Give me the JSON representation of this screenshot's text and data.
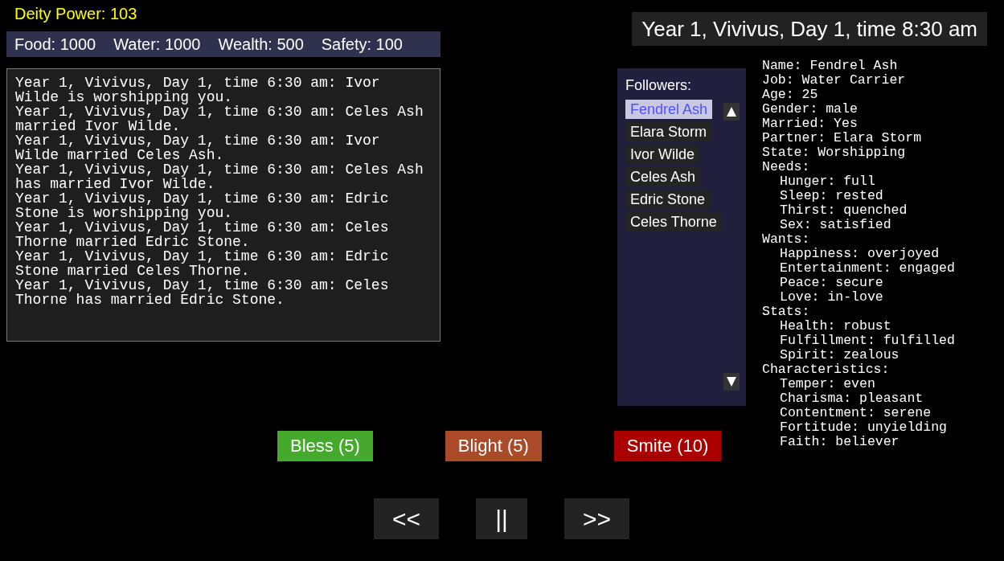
{
  "deity_power": "Deity Power: 103",
  "resources": [
    "Food: 1000",
    "Water: 1000",
    "Wealth: 500",
    "Safety: 100"
  ],
  "log": [
    "Year 1, Vivivus, Day 1, time 6:30 am: Ivor Wilde is worshipping you.",
    "Year 1, Vivivus, Day 1, time 6:30 am: Celes Ash married Ivor Wilde.",
    "Year 1, Vivivus, Day 1, time 6:30 am: Ivor Wilde married Celes Ash.",
    "Year 1, Vivivus, Day 1, time 6:30 am: Celes Ash has married Ivor Wilde.",
    "Year 1, Vivivus, Day 1, time 6:30 am: Edric Stone is worshipping you.",
    "Year 1, Vivivus, Day 1, time 6:30 am: Celes Thorne married Edric Stone.",
    "Year 1, Vivivus, Day 1, time 6:30 am: Edric Stone married Celes Thorne.",
    "Year 1, Vivivus, Day 1, time 6:30 am: Celes Thorne has married Edric Stone."
  ],
  "date": "Year 1, Vivivus, Day 1, time 8:30 am",
  "followers": {
    "title": "Followers:",
    "items": [
      {
        "name": "Fendrel Ash",
        "selected": true
      },
      {
        "name": "Elara Storm",
        "selected": false
      },
      {
        "name": "Ivor Wilde",
        "selected": false
      },
      {
        "name": "Celes Ash",
        "selected": false
      },
      {
        "name": "Edric Stone",
        "selected": false
      },
      {
        "name": "Celes Thorne",
        "selected": false
      }
    ]
  },
  "details": [
    {
      "text": "Name: Fendrel Ash"
    },
    {
      "text": "Job: Water Carrier"
    },
    {
      "text": "Age: 25"
    },
    {
      "text": "Gender: male"
    },
    {
      "text": "Married: Yes"
    },
    {
      "text": "Partner: Elara Storm"
    },
    {
      "text": "State: Worshipping"
    },
    {
      "text": "Needs:",
      "children": [
        {
          "text": "Hunger: full"
        },
        {
          "text": "Sleep: rested"
        },
        {
          "text": "Thirst: quenched"
        },
        {
          "text": "Sex: satisfied"
        }
      ]
    },
    {
      "text": "Wants:",
      "children": [
        {
          "text": "Happiness: overjoyed"
        },
        {
          "text": "Entertainment: engaged"
        },
        {
          "text": "Peace: secure"
        },
        {
          "text": "Love: in-love"
        }
      ]
    },
    {
      "text": "Stats:",
      "children": [
        {
          "text": "Health: robust"
        },
        {
          "text": "Fulfillment: fulfilled"
        },
        {
          "text": "Spirit: zealous"
        }
      ]
    },
    {
      "text": "Characteristics:",
      "children": [
        {
          "text": "Temper: even"
        },
        {
          "text": "Charisma: pleasant"
        },
        {
          "text": "Contentment: serene"
        },
        {
          "text": "Fortitude: unyielding"
        },
        {
          "text": "Faith: believer"
        }
      ]
    }
  ],
  "actions": [
    {
      "label": "Bless (5)",
      "kind": "bless"
    },
    {
      "label": "Blight (5)",
      "kind": "blight"
    },
    {
      "label": "Smite (10)",
      "kind": "smite"
    }
  ],
  "controls": [
    "<<",
    "||",
    ">>"
  ]
}
